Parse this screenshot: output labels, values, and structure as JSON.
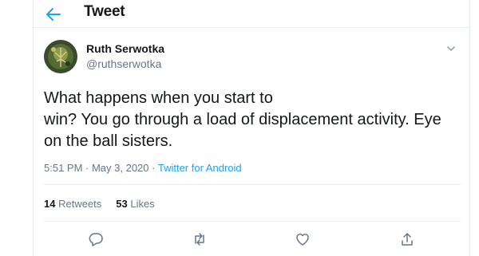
{
  "header": {
    "title": "Tweet"
  },
  "author": {
    "name": "Ruth Serwotka",
    "handle": "@ruthserwotka"
  },
  "tweet": {
    "lines": [
      "What happens when you start to",
      "win? You go through a load of displacement activity. Eye",
      "on the ball sisters."
    ],
    "timestamp": "5:51 PM · May 3, 2020 · ",
    "source": "Twitter for Android"
  },
  "stats": {
    "retweets_count": "14",
    "retweets_label": "Retweets",
    "likes_count": "53",
    "likes_label": "Likes"
  },
  "actions": [
    "reply-icon",
    "retweet-icon",
    "like-icon",
    "share-icon"
  ],
  "colors": {
    "accent": "#1da1f2",
    "text": "#14171a",
    "secondary": "#657786",
    "border": "#e6ecf0"
  }
}
